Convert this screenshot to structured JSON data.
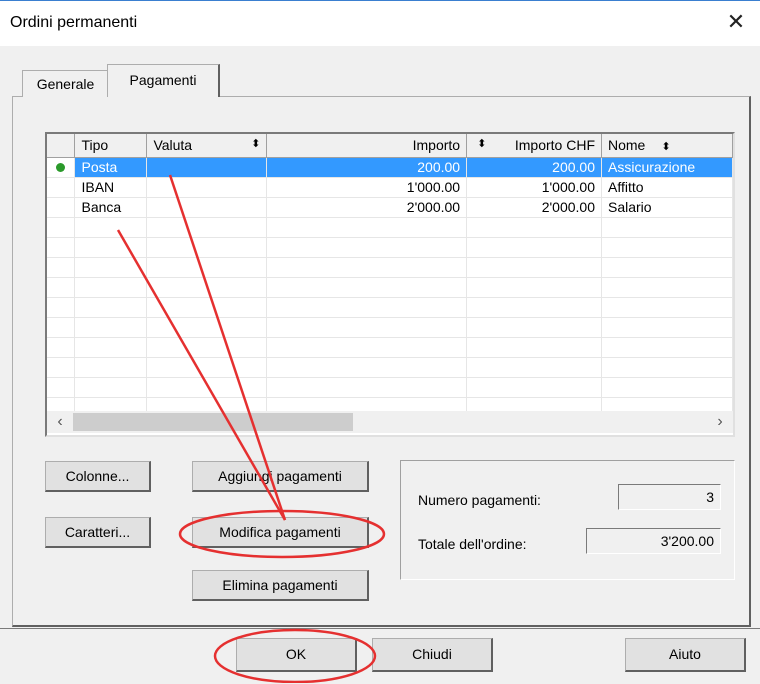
{
  "window": {
    "title": "Ordini permanenti",
    "close_glyph": "✕"
  },
  "tabs": [
    {
      "label": "Generale"
    },
    {
      "label": "Pagamenti"
    }
  ],
  "grid": {
    "columns": [
      "Tipo",
      "Valuta",
      "Importo",
      "Importo CHF",
      "Nome"
    ],
    "sort_glyph": "⬍",
    "rows": [
      {
        "tipo": "Posta",
        "valuta": "",
        "importo": "200.00",
        "importo_chf": "200.00",
        "nome": "Assicurazione",
        "selected": true
      },
      {
        "tipo": "IBAN",
        "valuta": "",
        "importo": "1'000.00",
        "importo_chf": "1'000.00",
        "nome": "Affitto"
      },
      {
        "tipo": "Banca",
        "valuta": "",
        "importo": "2'000.00",
        "importo_chf": "2'000.00",
        "nome": "Salario"
      }
    ]
  },
  "buttons": {
    "colonne": "Colonne...",
    "caratteri": "Caratteri...",
    "aggiungi": "Aggiungi pagamenti",
    "modifica": "Modifica pagamenti",
    "elimina": "Elimina pagamenti",
    "ok": "OK",
    "chiudi": "Chiudi",
    "aiuto": "Aiuto"
  },
  "summary": {
    "numero_label": "Numero pagamenti:",
    "numero_value": "3",
    "totale_label": "Totale dell'ordine:",
    "totale_value": "3'200.00"
  },
  "colors": {
    "selection": "#3399ff",
    "annotation": "#e53030",
    "status_dot": "#2b9a2b"
  }
}
